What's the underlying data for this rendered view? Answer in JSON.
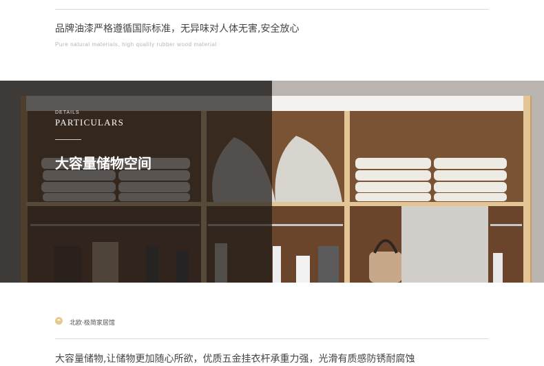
{
  "top_section": {
    "headline": "品牌油漆严格遵循国际标准，无异味对人体无害,安全放心",
    "subline": "Pure natural materials, high quality rubber wood material"
  },
  "banner": {
    "details_small": "DETAILS",
    "details_big": "PARTICULARS",
    "title": "大容量储物空间"
  },
  "bottom_section": {
    "brand": "北欧·极简家居馆",
    "headline": "大容量储物,让储物更加随心所欲，优质五金挂衣杆承重力强，光滑有质感防锈耐腐蚀"
  },
  "colors": {
    "accent": "#e6c98f",
    "overlay": "#1e1a18",
    "wood": "#d9b889"
  }
}
